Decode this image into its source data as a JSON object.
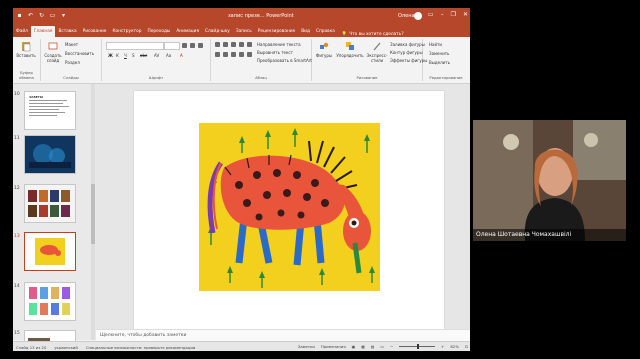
{
  "app": {
    "title": "запис презе... PowerPoint",
    "user_name": "Олена",
    "window_controls": [
      "minimize-icon",
      "restore-icon",
      "close-icon"
    ]
  },
  "menu": {
    "tabs": [
      "Файл",
      "Главная",
      "Вставка",
      "Рисование",
      "Конструктор",
      "Переходы",
      "Анимация",
      "Слайд-шоу",
      "Запись",
      "Рецензирование",
      "Вид",
      "Справка"
    ],
    "active_index": 1,
    "tell_me": "Что вы хотите сделать?"
  },
  "ribbon": {
    "groups": {
      "clipboard": "Буфер обмена",
      "slides": "Слайды",
      "font": "Шрифт",
      "paragraph": "Абзац",
      "drawing": "Рисование",
      "editing": "Редактирование"
    },
    "buttons": {
      "paste": "Вставить",
      "new_slide": "Создать слайд",
      "layout": "Макет",
      "reset": "Восстановить",
      "section": "Раздел",
      "shapes": "Фигуры",
      "arrange": "Упорядочить",
      "quick_styles": "Экспресс-стили",
      "shape_fill": "Заливка фигуры",
      "shape_outline": "Контур фигуры",
      "shape_effects": "Эффекты фигуры",
      "text_direction": "Направление текста",
      "align_text": "Выровнять текст",
      "smartart": "Преобразовать в SmartArt",
      "find": "Найти",
      "replace": "Заменить",
      "select": "Выделить"
    }
  },
  "slides_panel": {
    "numbers": [
      "10",
      "11",
      "12",
      "13",
      "14",
      "15"
    ],
    "selected": "13",
    "first_slide_title": "ЗАВЕТЫ"
  },
  "notes": {
    "placeholder": "Щелкните, чтобы добавить заметки"
  },
  "status": {
    "slide_info": "Слайд 13 из 20",
    "language": "украинский",
    "accessibility": "Специальные возможности: проверьте рекомендации",
    "notes_btn": "Заметки",
    "comments_btn": "Примечания",
    "zoom": "82%"
  },
  "webcam": {
    "caption": "Олена Шотаевна Чомахашвілі"
  },
  "colors": {
    "accent": "#b7472a",
    "painting_bg": "#f3cf1e",
    "animal": "#e8553a"
  }
}
